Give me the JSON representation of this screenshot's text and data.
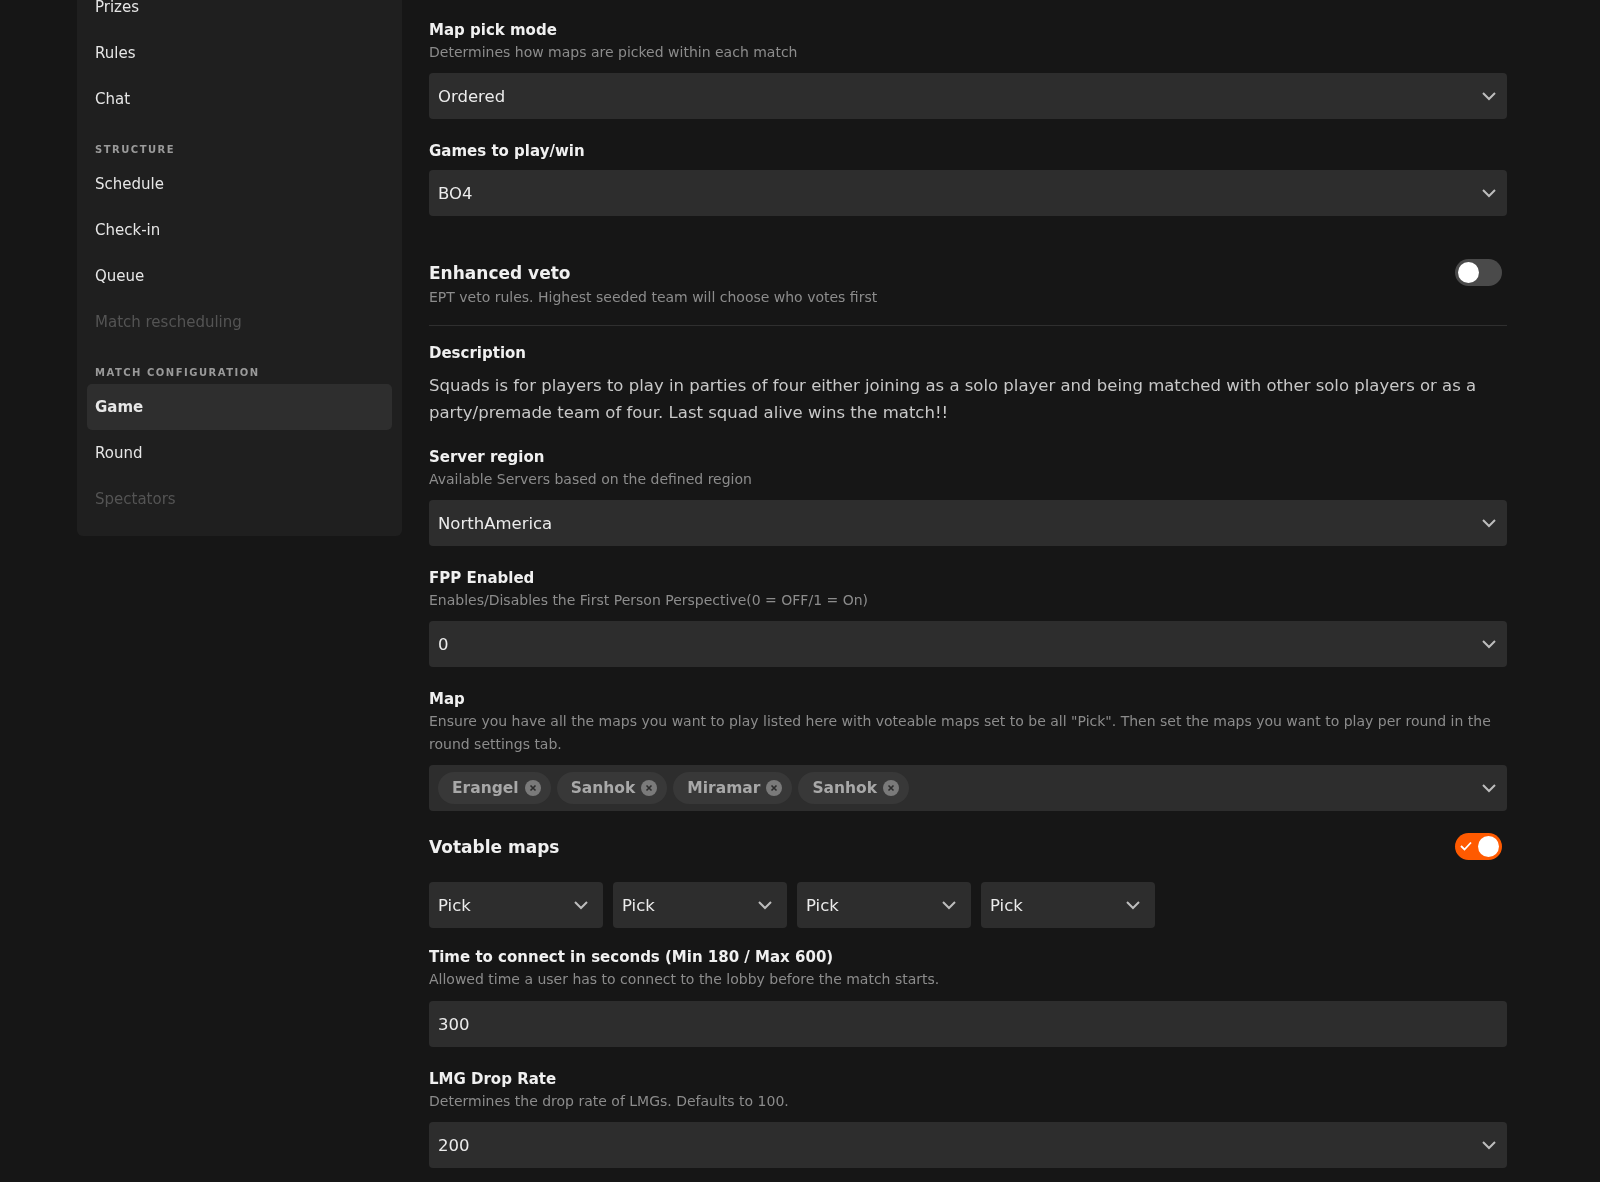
{
  "sidebar": {
    "items": [
      {
        "kind": "item",
        "label": "Prizes",
        "selected": false,
        "disabled": false
      },
      {
        "kind": "item",
        "label": "Rules",
        "selected": false,
        "disabled": false
      },
      {
        "kind": "item",
        "label": "Chat",
        "selected": false,
        "disabled": false
      },
      {
        "kind": "heading",
        "label": "STRUCTURE"
      },
      {
        "kind": "item",
        "label": "Schedule",
        "selected": false,
        "disabled": false
      },
      {
        "kind": "item",
        "label": "Check-in",
        "selected": false,
        "disabled": false
      },
      {
        "kind": "item",
        "label": "Queue",
        "selected": false,
        "disabled": false
      },
      {
        "kind": "item",
        "label": "Match rescheduling",
        "selected": false,
        "disabled": true
      },
      {
        "kind": "heading",
        "label": "MATCH CONFIGURATION"
      },
      {
        "kind": "item",
        "label": "Game",
        "selected": true,
        "disabled": false
      },
      {
        "kind": "item",
        "label": "Round",
        "selected": false,
        "disabled": false
      },
      {
        "kind": "item",
        "label": "Spectators",
        "selected": false,
        "disabled": true
      }
    ]
  },
  "settings": [
    {
      "kind": "select",
      "label": "Map pick mode",
      "hint": "Determines how maps are picked within each match",
      "value": "Ordered"
    },
    {
      "kind": "select",
      "label": "Games to play/win",
      "value": "BO4"
    },
    {
      "kind": "toggle",
      "label": "Enhanced veto",
      "hint": "EPT veto rules. Highest seeded team will choose who votes first",
      "on": false
    },
    {
      "kind": "text",
      "label": "Description",
      "text": "Squads is for players to play in parties of four either joining as a solo player and being matched with other solo players or as a party/premade team of four. Last squad alive wins the match!!"
    },
    {
      "kind": "select",
      "label": "Server region",
      "hint": "Available Servers based on the defined region",
      "value": "NorthAmerica"
    },
    {
      "kind": "select",
      "label": "FPP Enabled",
      "hint": "Enables/Disables the First Person Perspective(0 = OFF/1 = On)",
      "value": "0"
    },
    {
      "kind": "tags",
      "label": "Map",
      "hint": "Ensure you have all the maps you want to play listed here with voteable maps set to be all \"Pick\". Then set the maps you want to play per round in the round settings tab.",
      "tags": [
        "Erangel",
        "Sanhok",
        "Miramar",
        "Sanhok"
      ]
    },
    {
      "kind": "toggle",
      "label": "Votable maps",
      "on": true,
      "picks": [
        "Pick",
        "Pick",
        "Pick",
        "Pick"
      ]
    },
    {
      "kind": "input",
      "label": "Time to connect in seconds (Min 180 / Max 600)",
      "hint": "Allowed time a user has to connect to the lobby before the match starts.",
      "value": "300"
    },
    {
      "kind": "select",
      "label": "LMG Drop Rate",
      "hint": "Determines the drop rate of LMGs. Defaults to 100.",
      "value": "200"
    }
  ]
}
